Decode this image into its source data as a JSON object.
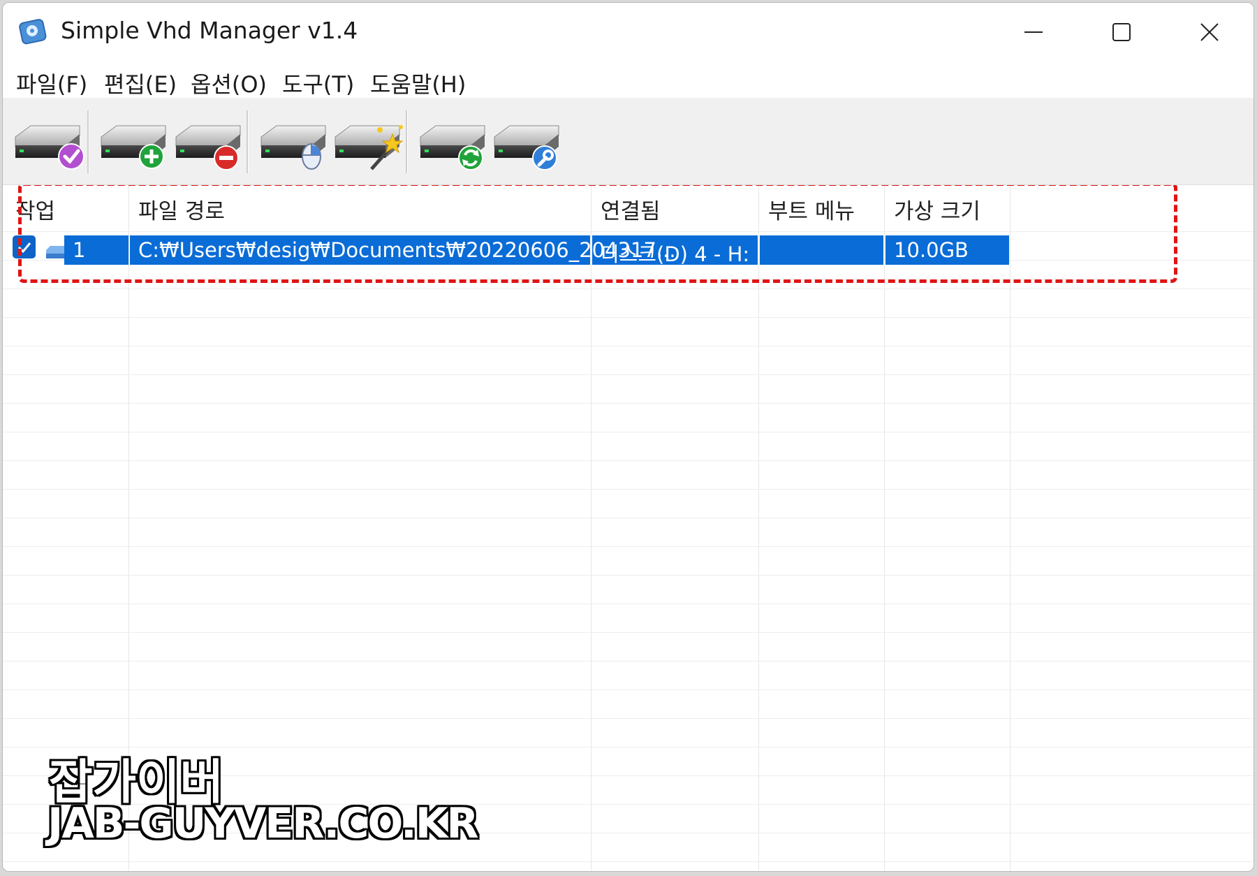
{
  "window": {
    "title": "Simple Vhd Manager v1.4",
    "app_icon": "vhd-disk-icon"
  },
  "menu": {
    "items": [
      "파일(F)",
      "편집(E)",
      "옵션(O)",
      "도구(T)",
      "도움말(H)"
    ]
  },
  "toolbar": {
    "buttons": [
      {
        "icon": "drive-check-icon"
      },
      {
        "icon": "drive-add-icon"
      },
      {
        "icon": "drive-remove-icon"
      },
      {
        "icon": "drive-mouse-icon"
      },
      {
        "icon": "drive-wand-icon"
      },
      {
        "icon": "drive-refresh-icon"
      },
      {
        "icon": "drive-tools-icon"
      }
    ]
  },
  "table": {
    "columns": [
      "작업",
      "파일 경로",
      "연결됨",
      "부트 메뉴",
      "가상 크기"
    ],
    "rows": [
      {
        "checked": true,
        "task": "1",
        "path": "C:₩Users₩desig₩Documents₩20220606_204317...",
        "connected": "디스크(D) 4  -  H:",
        "boot_menu": "",
        "size": "10.0GB",
        "selected": true
      }
    ]
  },
  "colors": {
    "selection": "#0a6cd6",
    "highlight_border": "#e01414",
    "toolbar_bg": "#f0f0f0"
  },
  "watermark": {
    "line1": "잡가이버",
    "line2": "JAB-GUYVER.CO.KR"
  }
}
